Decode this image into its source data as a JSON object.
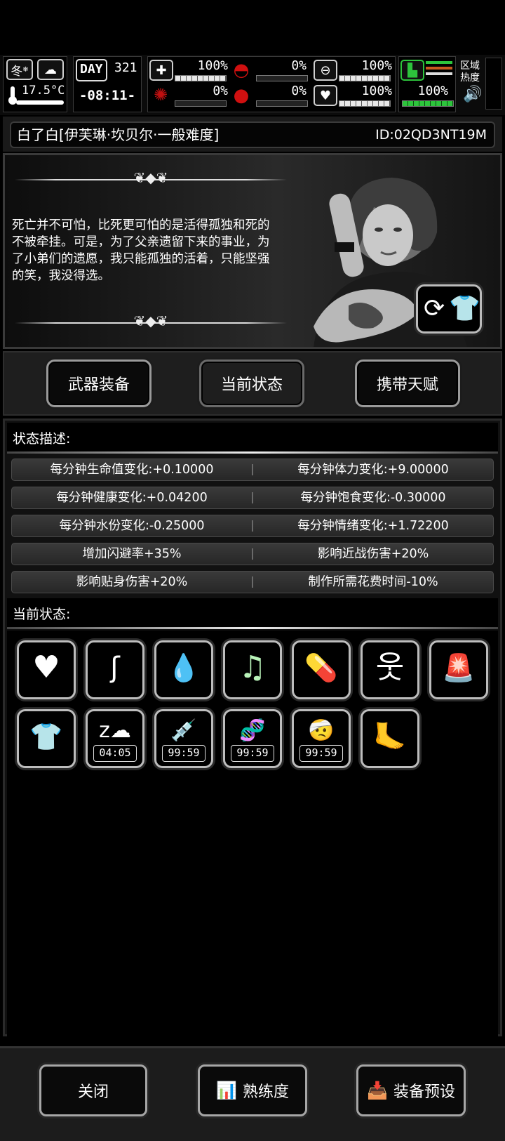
{
  "hud": {
    "season": "冬",
    "temperature": "17.5°C",
    "day_label": "DAY",
    "day_value": "321",
    "clock": "-08:11-",
    "stats": [
      {
        "icon": "medkit-icon",
        "value": "100%",
        "level": 1.0
      },
      {
        "icon": "stomach-icon",
        "value": "0%",
        "level": 0.0
      },
      {
        "icon": "pill-icon",
        "value": "100%",
        "level": 1.0
      },
      {
        "icon": "brain-icon",
        "value": "0%",
        "level": 0.0
      },
      {
        "icon": "blood-drop-icon",
        "value": "0%",
        "level": 0.0
      },
      {
        "icon": "heart-icon",
        "value": "100%",
        "level": 1.0
      }
    ],
    "stamina": "100%",
    "area_heat_label": "区域热度",
    "volume_icon": "speaker-icon"
  },
  "character": {
    "title": "白了白[伊芙琳·坎贝尔·一般难度]",
    "id": "ID:02QD3NT19M",
    "quote": "死亡并不可怕，比死更可怕的是活得孤独和死的不被牵挂。可是，为了父亲遗留下来的事业，为了小弟们的遗愿，我只能孤独的活着，只能坚强的笑，我没得选。"
  },
  "tabs": [
    "武器装备",
    "当前状态",
    "携带天赋"
  ],
  "status_desc_label": "状态描述:",
  "stats_rows": [
    [
      "每分钟生命值变化:+0.10000",
      "每分钟体力变化:+9.00000"
    ],
    [
      "每分钟健康变化:+0.04200",
      "每分钟饱食变化:-0.30000"
    ],
    [
      "每分钟水份变化:-0.25000",
      "每分钟情绪变化:+1.72200"
    ],
    [
      "增加闪避率+35%",
      "影响近战伤害+20%"
    ],
    [
      "影响贴身伤害+20%",
      "制作所需花费时间-10%"
    ]
  ],
  "current_status_label": "当前状态:",
  "status_icons_row1": [
    "heart-icon",
    "stomach-icon",
    "water-drop-icon",
    "music-heart-icon",
    "medicine-icon",
    "strong-man-icon",
    "alarm-light-icon"
  ],
  "status_icons_row2": [
    {
      "icon": "shirt-icon",
      "timer": ""
    },
    {
      "icon": "sleep-icon",
      "timer": "04:05"
    },
    {
      "icon": "syringe-icon",
      "timer": "99:59"
    },
    {
      "icon": "dna-icon",
      "timer": "99:59"
    },
    {
      "icon": "wounded-icon",
      "timer": "99:59"
    },
    {
      "icon": "fast-foot-icon",
      "timer": ""
    }
  ],
  "bottom_buttons": {
    "close": "关闭",
    "proficiency": "熟练度",
    "preset": "装备预设"
  },
  "colors": {
    "stamina_green": "#2dc43c",
    "stomach_red": "#d01010"
  }
}
